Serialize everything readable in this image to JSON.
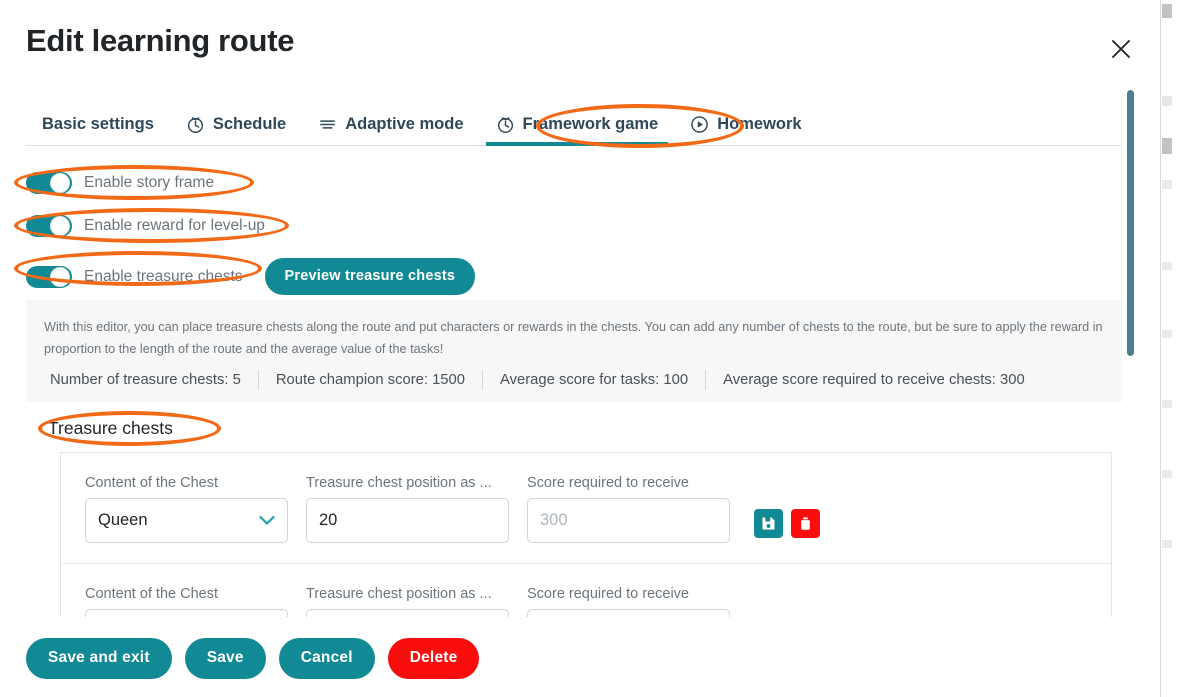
{
  "modal": {
    "title": "Edit learning route",
    "close_icon": "close-icon"
  },
  "tabs": [
    {
      "label": "Basic settings",
      "icon": "",
      "active": false
    },
    {
      "label": "Schedule",
      "icon": "clock-icon",
      "active": false
    },
    {
      "label": "Adaptive mode",
      "icon": "sliders-icon",
      "active": false
    },
    {
      "label": "Framework game",
      "icon": "clock-icon",
      "active": true
    },
    {
      "label": "Homework",
      "icon": "play-circle-icon",
      "active": false
    }
  ],
  "toggles": [
    {
      "label": "Enable story frame",
      "on": true
    },
    {
      "label": "Enable reward for level-up",
      "on": true
    },
    {
      "label": "Enable treasure chests",
      "on": true
    }
  ],
  "preview_button": {
    "label": "Preview treasure chests"
  },
  "info": {
    "text": "With this editor, you can place treasure chests along the route and put characters or rewards in the chests. You can add any number of chests to the route, but be sure to apply the reward in proportion to the length of the route and the average value of the tasks!",
    "stats": [
      "Number of treasure chests: 5",
      "Route champion score: 1500",
      "Average score for tasks: 100",
      "Average score required to receive chests: 300"
    ]
  },
  "section": {
    "heading": "Treasure chests"
  },
  "chest_rows": [
    {
      "content_label": "Content of the Chest",
      "content_value": "Queen",
      "position_label": "Treasure chest position as ...",
      "position_value": "20",
      "score_label": "Score required to receive",
      "score_value": "",
      "score_placeholder": "300",
      "save_icon": "save-icon",
      "delete_icon": "trash-icon"
    },
    {
      "content_label": "Content of the Chest",
      "content_value": "",
      "position_label": "Treasure chest position as ...",
      "position_value": "",
      "score_label": "Score required to receive",
      "score_value": "",
      "score_placeholder": "",
      "save_icon": "save-icon",
      "delete_icon": "trash-icon"
    }
  ],
  "footer": {
    "save_and_exit": "Save and exit",
    "save": "Save",
    "cancel": "Cancel",
    "delete": "Delete"
  },
  "colors": {
    "teal": "#128a96",
    "red": "#fa0d0d",
    "annotation_orange": "#f26a16",
    "scrollbar": "#4a7f91"
  }
}
